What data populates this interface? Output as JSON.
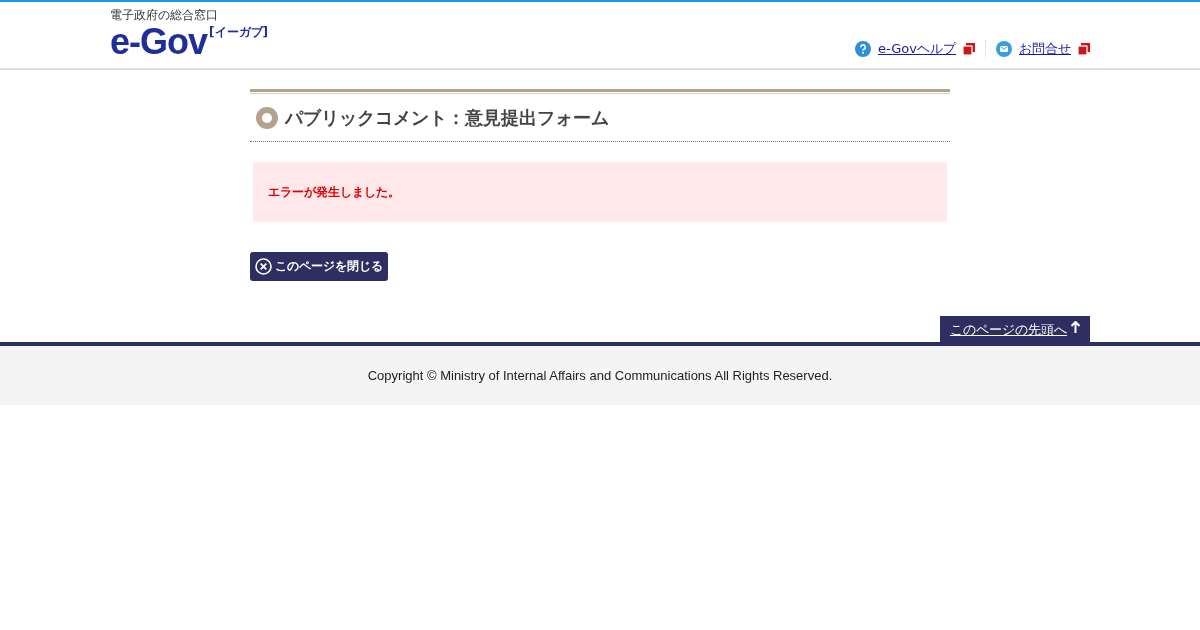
{
  "header": {
    "logo": {
      "tagline": "電子政府の総合窓口",
      "name": "e-Gov",
      "reading": "[イーガブ]"
    },
    "links": [
      {
        "kind": "help",
        "label": "e-Govヘルプ"
      },
      {
        "kind": "mail",
        "label": "お問合せ"
      }
    ]
  },
  "page": {
    "title": "パブリックコメント：意見提出フォーム",
    "error": "エラーが発生しました。",
    "close_button": "このページを閉じる"
  },
  "back_to_top": "このページの先頭へ",
  "footer": {
    "copyright": "Copyright © Ministry of Internal Affairs and Communications All Rights Reserved."
  }
}
